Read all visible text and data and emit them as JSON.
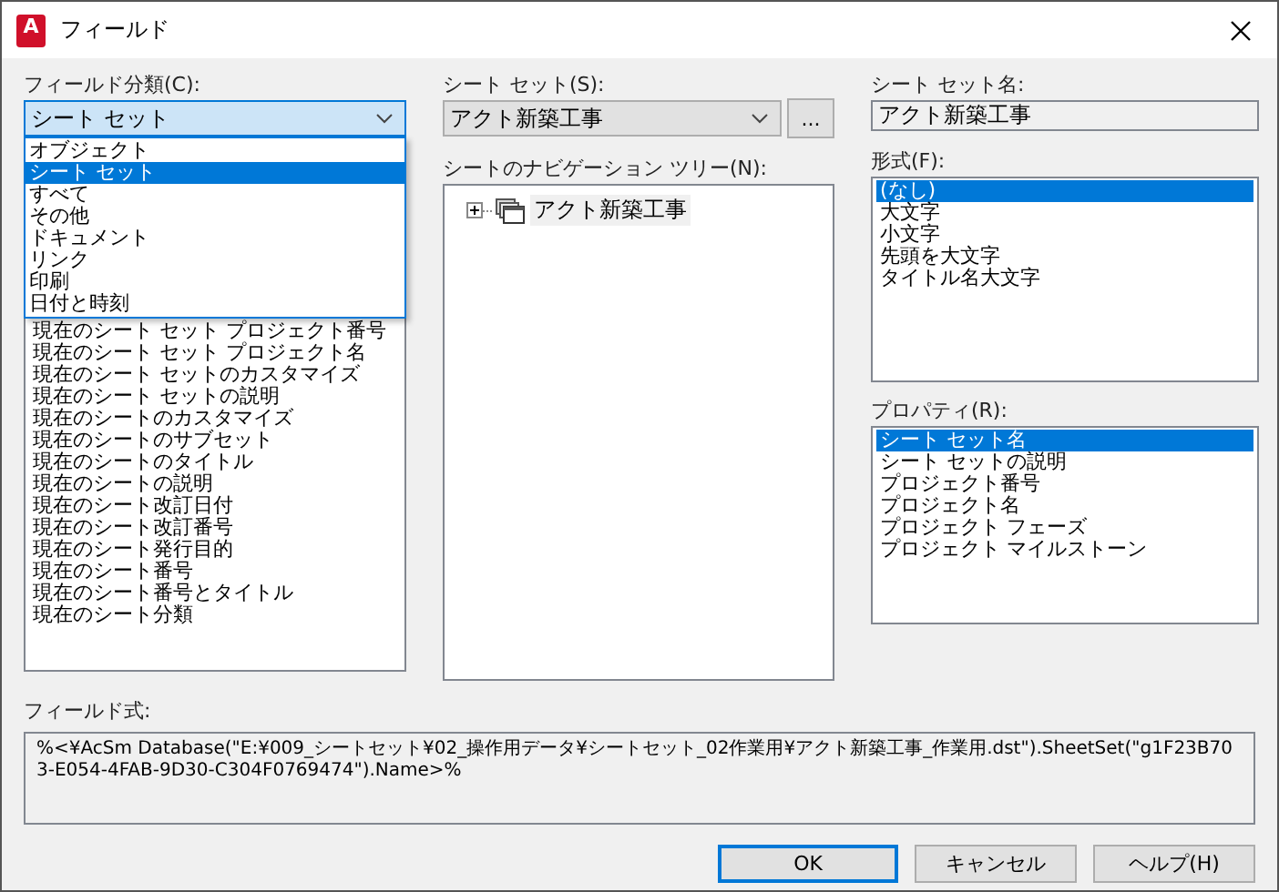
{
  "window": {
    "title": "フィールド",
    "logo_letter": "A"
  },
  "field_category": {
    "label": "フィールド分類(C):",
    "value": "シート セット",
    "options": [
      {
        "label": "オブジェクト",
        "selected": false
      },
      {
        "label": "シート セット",
        "selected": true
      },
      {
        "label": "すべて",
        "selected": false
      },
      {
        "label": "その他",
        "selected": false
      },
      {
        "label": "ドキュメント",
        "selected": false
      },
      {
        "label": "リンク",
        "selected": false
      },
      {
        "label": "印刷",
        "selected": false
      },
      {
        "label": "日付と時刻",
        "selected": false
      }
    ],
    "fields": [
      "現在のシート セット プロジェクト番号",
      "現在のシート セット プロジェクト名",
      "現在のシート セットのカスタマイズ",
      "現在のシート セットの説明",
      "現在のシートのカスタマイズ",
      "現在のシートのサブセット",
      "現在のシートのタイトル",
      "現在のシートの説明",
      "現在のシート改訂日付",
      "現在のシート改訂番号",
      "現在のシート発行目的",
      "現在のシート番号",
      "現在のシート番号とタイトル",
      "現在のシート分類"
    ]
  },
  "sheet_set": {
    "label": "シート セット(S):",
    "value": "アクト新築工事",
    "browse_button": "..."
  },
  "navigation_tree": {
    "label": "シートのナビゲーション ツリー(N):",
    "items": [
      {
        "label": "アクト新築工事",
        "expanded": false
      }
    ]
  },
  "sheet_set_name": {
    "label": "シート セット名:",
    "value": "アクト新築工事"
  },
  "format": {
    "label": "形式(F):",
    "items": [
      {
        "label": "(なし)",
        "selected": true
      },
      {
        "label": "大文字",
        "selected": false
      },
      {
        "label": "小文字",
        "selected": false
      },
      {
        "label": "先頭を大文字",
        "selected": false
      },
      {
        "label": "タイトル名大文字",
        "selected": false
      }
    ]
  },
  "properties": {
    "label": "プロパティ(R):",
    "items": [
      {
        "label": "シート セット名",
        "selected": true
      },
      {
        "label": "シート セットの説明",
        "selected": false
      },
      {
        "label": "プロジェクト番号",
        "selected": false
      },
      {
        "label": "プロジェクト名",
        "selected": false
      },
      {
        "label": "プロジェクト フェーズ",
        "selected": false
      },
      {
        "label": "プロジェクト マイルストーン",
        "selected": false
      }
    ]
  },
  "field_expression": {
    "label": "フィールド式:",
    "value": "%<¥AcSm Database(\"E:¥009_シートセット¥02_操作用データ¥シートセット_02作業用¥アクト新築工事_作業用.dst\").SheetSet(\"g1F23B703-E054-4FAB-9D30-C304F0769474\").Name>%"
  },
  "buttons": [
    {
      "label": "OK",
      "default": true
    },
    {
      "label": "キャンセル",
      "default": false
    },
    {
      "label": "ヘルプ(H)",
      "default": false
    }
  ]
}
